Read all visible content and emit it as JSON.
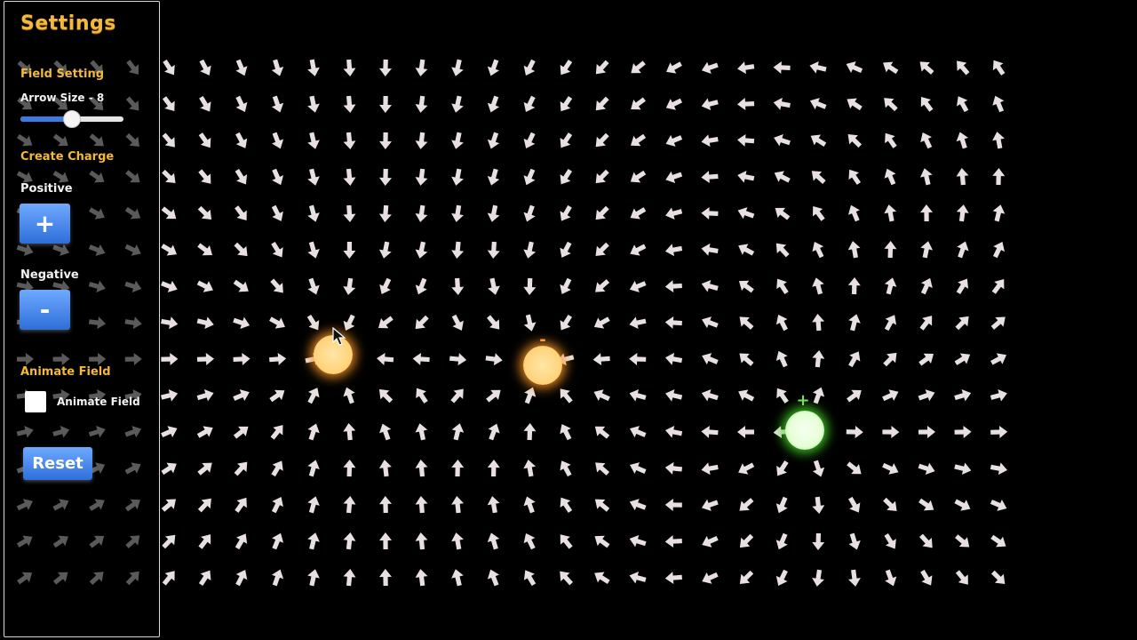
{
  "sidebar": {
    "title": "Settings",
    "field_setting_heading": "Field Setting",
    "arrow_size_label": "Arrow Size - 8",
    "arrow_size_value": 8,
    "arrow_size_min": 1,
    "arrow_size_max": 15,
    "create_charge_heading": "Create Charge",
    "positive_label": "Positive",
    "positive_button": "+",
    "negative_label": "Negative",
    "negative_button": "-",
    "animate_heading": "Animate Field",
    "animate_checkbox_label": "Animate Field",
    "animate_checked": false,
    "reset_button": "Reset"
  },
  "charges": [
    {
      "sign": "-",
      "label": "",
      "color": "#ffd37a"
    },
    {
      "sign": "-",
      "label": "-",
      "color": "#ffd37a"
    },
    {
      "sign": "+",
      "label": "+",
      "color": "#e6ffd6"
    }
  ],
  "colors": {
    "accent": "#f3b93a",
    "button": "#3b7ae0",
    "arrow": "#e8e0e0",
    "arrow_dim": "#5a5a5a",
    "background": "#000000"
  },
  "icons": {
    "cursor": "mouse-pointer-icon"
  }
}
